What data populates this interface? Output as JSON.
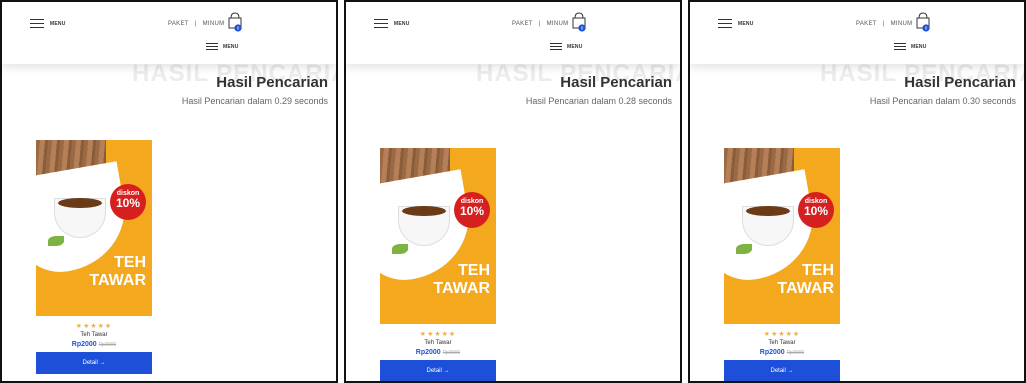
{
  "panels": [
    {
      "menu_label": "MENU",
      "nav": [
        "PAKET",
        "|",
        "MINUM"
      ],
      "cart_count": "0",
      "menu2_label": "MENU",
      "watermark": "HASIL PENCARIAN",
      "title": "Hasil Pencarian",
      "subtitle": "Hasil Pencarian dalam 0.29 seconds"
    },
    {
      "menu_label": "MENU",
      "nav": [
        "PAKET",
        "|",
        "MINUM"
      ],
      "cart_count": "0",
      "menu2_label": "MENU",
      "watermark": "HASIL PENCARIAN",
      "title": "Hasil Pencarian",
      "subtitle": "Hasil Pencarian dalam 0.28 seconds"
    },
    {
      "menu_label": "MENU",
      "nav": [
        "PAKET",
        "|",
        "MINUM"
      ],
      "cart_count": "0",
      "menu2_label": "MENU",
      "watermark": "HASIL PENCARIAN",
      "title": "Hasil Pencarian",
      "subtitle": "Hasil Pencarian dalam 0.30 seconds"
    }
  ],
  "product": {
    "badge_line1": "diskon",
    "badge_line2": "10%",
    "poster_name_1": "TEH",
    "poster_name_2": "TAWAR",
    "rating": 5,
    "stars": "★★★★★",
    "name": "Teh Tawar",
    "price": "Rp2000",
    "old_price": "Rp3000",
    "detail_label": "Detail →"
  },
  "colors": {
    "accent": "#1d4fd8",
    "poster": "#f3a81d",
    "badge": "#d61f1f",
    "star": "#f1b23b"
  }
}
